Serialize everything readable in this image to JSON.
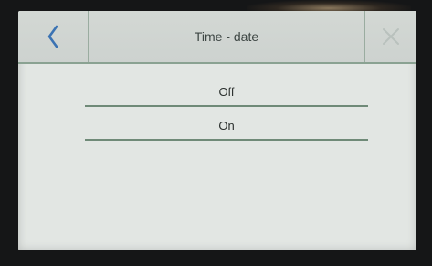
{
  "header": {
    "title": "Time - date",
    "back_icon": "chevron-left-icon",
    "close_icon": "close-icon"
  },
  "options": [
    {
      "label": "Off"
    },
    {
      "label": "On"
    }
  ],
  "colors": {
    "screen_background": "#e2e6e3",
    "header_background": "#d3d8d4",
    "accent_blue": "#3b73b3",
    "divider_green": "#6f8a78",
    "close_icon_gray": "#b9c1bd",
    "text": "#2b302e"
  }
}
